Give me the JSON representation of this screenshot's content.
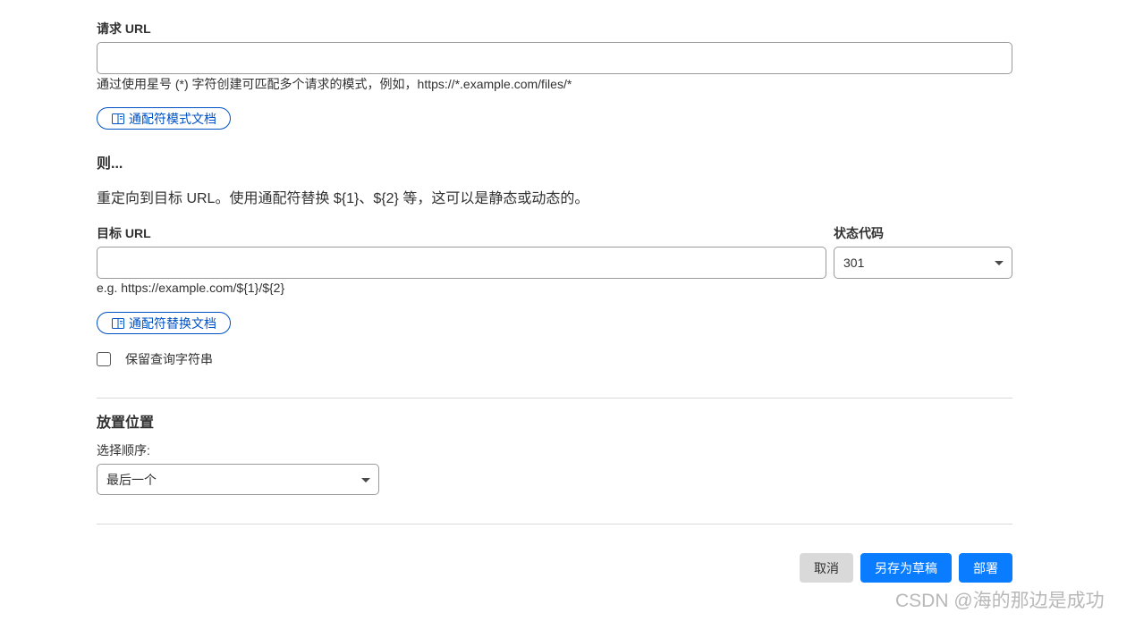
{
  "request_url": {
    "label": "请求 URL",
    "value": "",
    "hint": "通过使用星号 (*) 字符创建可匹配多个请求的模式，例如，https://*.example.com/files/*",
    "doc_link": "通配符模式文档"
  },
  "then": {
    "title": "则...",
    "description": "重定向到目标 URL。使用通配符替换 ${1}、${2} 等，这可以是静态或动态的。"
  },
  "target_url": {
    "label": "目标 URL",
    "value": "",
    "hint": "e.g. https://example.com/${1}/${2}",
    "doc_link": "通配符替换文档"
  },
  "status_code": {
    "label": "状态代码",
    "selected": "301"
  },
  "preserve_query": {
    "label": "保留查询字符串",
    "checked": false
  },
  "placement": {
    "title": "放置位置",
    "order_label": "选择顺序:",
    "order_selected": "最后一个"
  },
  "footer": {
    "cancel_label": "取消",
    "save_draft_label": "另存为草稿",
    "deploy_label": "部署"
  },
  "watermark": "CSDN @海的那边是成功",
  "colors": {
    "accent": "#0a7cff",
    "link": "#0051c3",
    "cancel_bg": "#d9d9d9"
  },
  "icons": {
    "doc_link_icon": "book-icon",
    "select_caret": "chevron-down-icon"
  }
}
